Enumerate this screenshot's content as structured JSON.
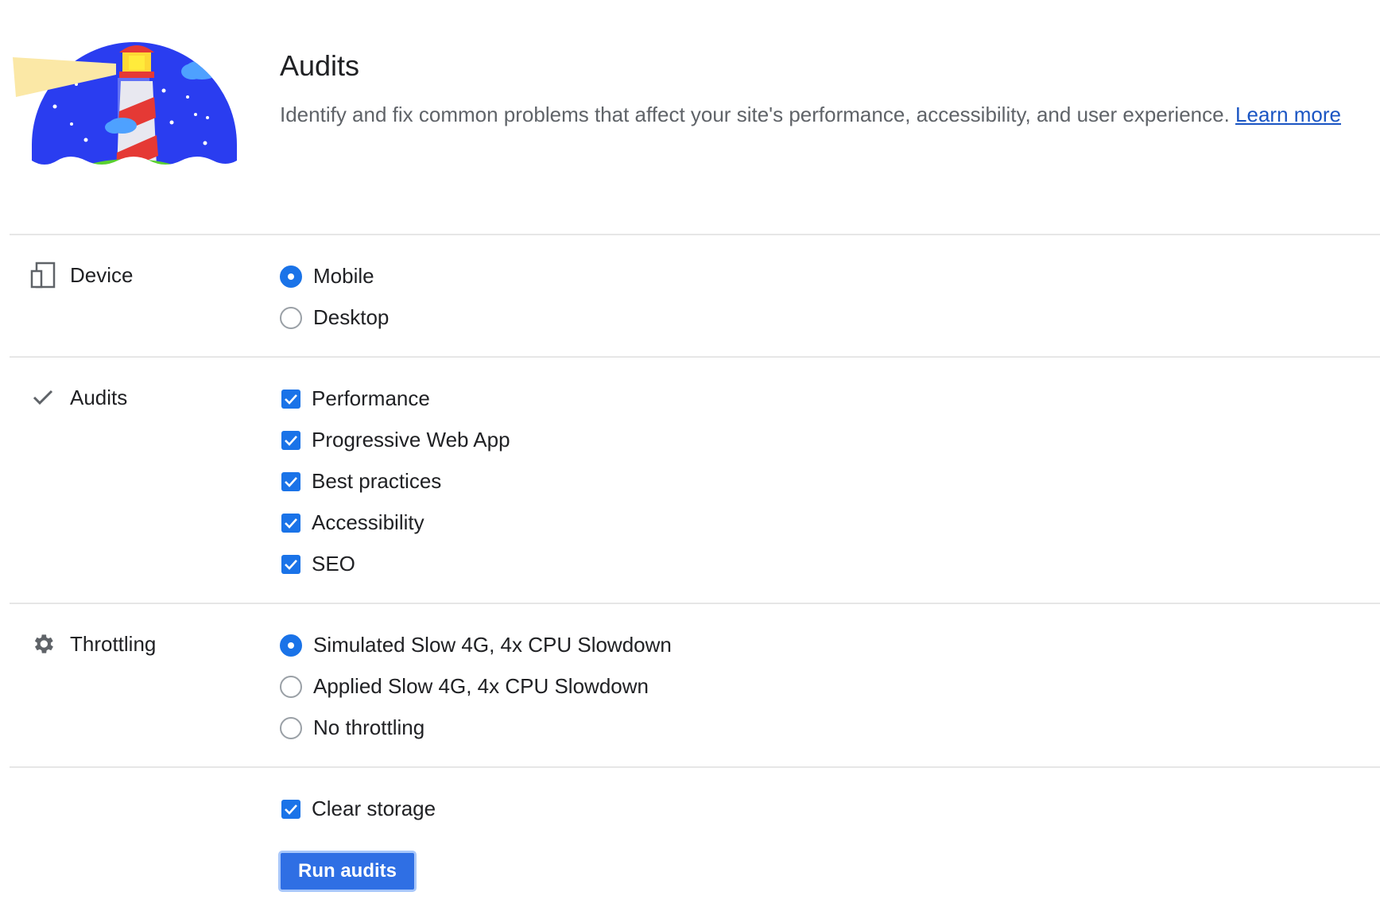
{
  "header": {
    "title": "Audits",
    "description": "Identify and fix common problems that affect your site's performance, accessibility, and user experience.",
    "learn_more": "Learn more"
  },
  "sections": {
    "device": {
      "label": "Device",
      "icon": "device-icon",
      "options": [
        {
          "label": "Mobile",
          "selected": true
        },
        {
          "label": "Desktop",
          "selected": false
        }
      ]
    },
    "audits": {
      "label": "Audits",
      "icon": "checkmark-icon",
      "options": [
        {
          "label": "Performance",
          "checked": true
        },
        {
          "label": "Progressive Web App",
          "checked": true
        },
        {
          "label": "Best practices",
          "checked": true
        },
        {
          "label": "Accessibility",
          "checked": true
        },
        {
          "label": "SEO",
          "checked": true
        }
      ]
    },
    "throttling": {
      "label": "Throttling",
      "icon": "gear-icon",
      "options": [
        {
          "label": "Simulated Slow 4G, 4x CPU Slowdown",
          "selected": true
        },
        {
          "label": "Applied Slow 4G, 4x CPU Slowdown",
          "selected": false
        },
        {
          "label": "No throttling",
          "selected": false
        }
      ]
    }
  },
  "clear_storage": {
    "label": "Clear storage",
    "checked": true
  },
  "run_button": "Run audits",
  "colors": {
    "accent": "#1a73e8",
    "link": "#1a55c3",
    "button": "#2f6fe4"
  }
}
